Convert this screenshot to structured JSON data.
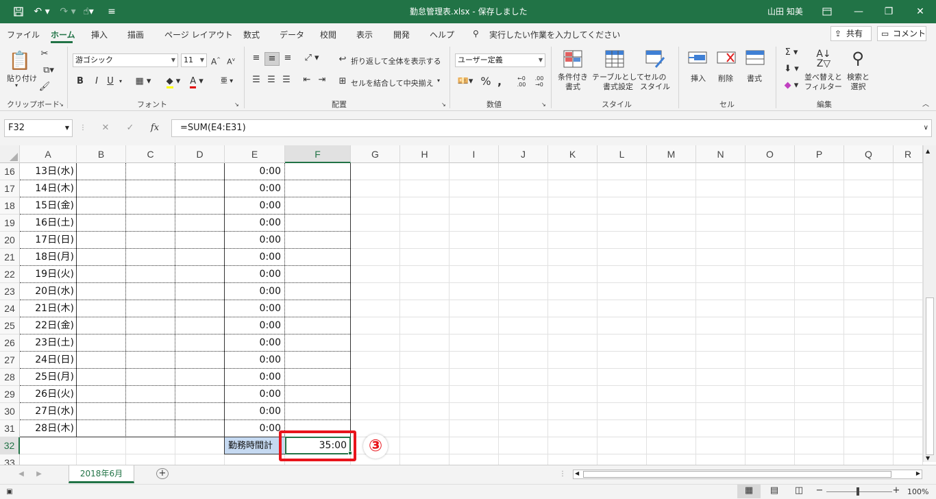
{
  "titlebar": {
    "title": "勤怠管理表.xlsx  -  保存しました",
    "user": "山田 知美",
    "icons": [
      "save-icon",
      "undo-icon",
      "redo-icon",
      "touch-mode-icon",
      "customize-icon",
      "ribbon-display-icon",
      "minimize-icon",
      "restore-icon",
      "close-icon"
    ]
  },
  "menu": {
    "items": [
      "ファイル",
      "ホーム",
      "挿入",
      "描画",
      "ページ レイアウト",
      "数式",
      "データ",
      "校閲",
      "表示",
      "開発",
      "ヘルプ"
    ],
    "active": "ホーム",
    "search_placeholder": "実行したい作業を入力してください",
    "share": "共有",
    "comment": "コメント"
  },
  "ribbon": {
    "clipboard": {
      "paste": "貼り付け",
      "label": "クリップボード"
    },
    "font": {
      "font_name": "游ゴシック",
      "font_size": "11",
      "bold": "B",
      "italic": "I",
      "underline": "U",
      "label": "フォント"
    },
    "alignment": {
      "wrap": "折り返して全体を表示する",
      "merge": "セルを結合して中央揃え",
      "label": "配置"
    },
    "number": {
      "format": "ユーザー定義",
      "label": "数値"
    },
    "styles": {
      "conditional": "条件付き\n書式",
      "table": "テーブルとして\n書式設定",
      "cell_styles": "セルの\nスタイル",
      "label": "スタイル"
    },
    "cells": {
      "insert": "挿入",
      "delete": "削除",
      "format": "書式",
      "label": "セル"
    },
    "editing": {
      "sort": "並べ替えと\nフィルター",
      "find": "検索と\n選択",
      "label": "編集"
    }
  },
  "formula_bar": {
    "name_box": "F32",
    "fx": "fx",
    "formula": "=SUM(E4:E31)"
  },
  "columns": [
    "A",
    "B",
    "C",
    "D",
    "E",
    "F",
    "G",
    "H",
    "I",
    "J",
    "K",
    "L",
    "M",
    "N",
    "O",
    "P",
    "Q",
    "R"
  ],
  "selected_column": "F",
  "rows": [
    {
      "num": "16",
      "a": "13日(水)",
      "e": "0:00"
    },
    {
      "num": "17",
      "a": "14日(木)",
      "e": "0:00"
    },
    {
      "num": "18",
      "a": "15日(金)",
      "e": "0:00"
    },
    {
      "num": "19",
      "a": "16日(土)",
      "e": "0:00"
    },
    {
      "num": "20",
      "a": "17日(日)",
      "e": "0:00"
    },
    {
      "num": "21",
      "a": "18日(月)",
      "e": "0:00"
    },
    {
      "num": "22",
      "a": "19日(火)",
      "e": "0:00"
    },
    {
      "num": "23",
      "a": "20日(水)",
      "e": "0:00"
    },
    {
      "num": "24",
      "a": "21日(木)",
      "e": "0:00"
    },
    {
      "num": "25",
      "a": "22日(金)",
      "e": "0:00"
    },
    {
      "num": "26",
      "a": "23日(土)",
      "e": "0:00"
    },
    {
      "num": "27",
      "a": "24日(日)",
      "e": "0:00"
    },
    {
      "num": "28",
      "a": "25日(月)",
      "e": "0:00"
    },
    {
      "num": "29",
      "a": "26日(火)",
      "e": "0:00"
    },
    {
      "num": "30",
      "a": "27日(水)",
      "e": "0:00"
    },
    {
      "num": "31",
      "a": "28日(木)",
      "e": "0:00"
    },
    {
      "num": "32",
      "a": "",
      "e": "勤務時間計",
      "f": "35:00"
    },
    {
      "num": "33",
      "a": "",
      "e": ""
    }
  ],
  "selected_row": "32",
  "annotation": {
    "marker": "③",
    "color": "#e8141b"
  },
  "sheet": {
    "tab": "2018年6月"
  },
  "status": {
    "zoom": "100%"
  },
  "colors": {
    "excel_green": "#217346",
    "total_label_bg": "#c5d9f1"
  }
}
